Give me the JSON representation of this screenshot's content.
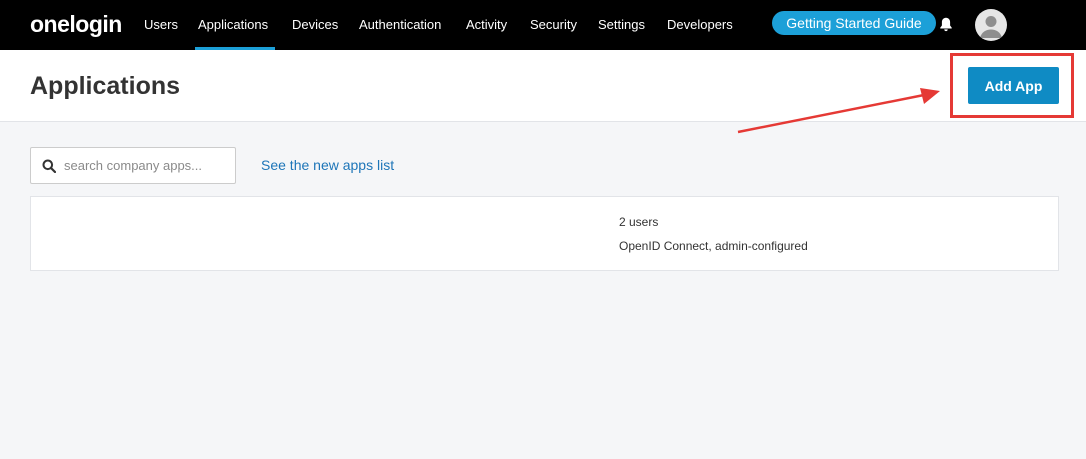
{
  "nav": {
    "logo": "onelogin",
    "items": [
      {
        "label": "Users",
        "active": false
      },
      {
        "label": "Applications",
        "active": true
      },
      {
        "label": "Devices",
        "active": false
      },
      {
        "label": "Authentication",
        "active": false
      },
      {
        "label": "Activity",
        "active": false
      },
      {
        "label": "Security",
        "active": false
      },
      {
        "label": "Settings",
        "active": false
      },
      {
        "label": "Developers",
        "active": false
      }
    ],
    "guide_label": "Getting Started Guide",
    "icons": {
      "notifications": "bell-icon",
      "profile": "avatar-icon"
    }
  },
  "header": {
    "title": "Applications",
    "add_app_label": "Add App"
  },
  "toolbar": {
    "search_placeholder": "search company apps...",
    "search_value": "",
    "new_apps_link": "See the new apps list"
  },
  "apps": [
    {
      "name": "",
      "users": "2 users",
      "meta": "OpenID Connect, admin-configured"
    }
  ],
  "annotation": {
    "highlight_color": "#e53935",
    "arrow_color": "#e53935"
  },
  "colors": {
    "accent": "#1ca0d8",
    "button": "#0f8bc4",
    "link": "#1d75b8",
    "nav_bg": "#000000"
  }
}
